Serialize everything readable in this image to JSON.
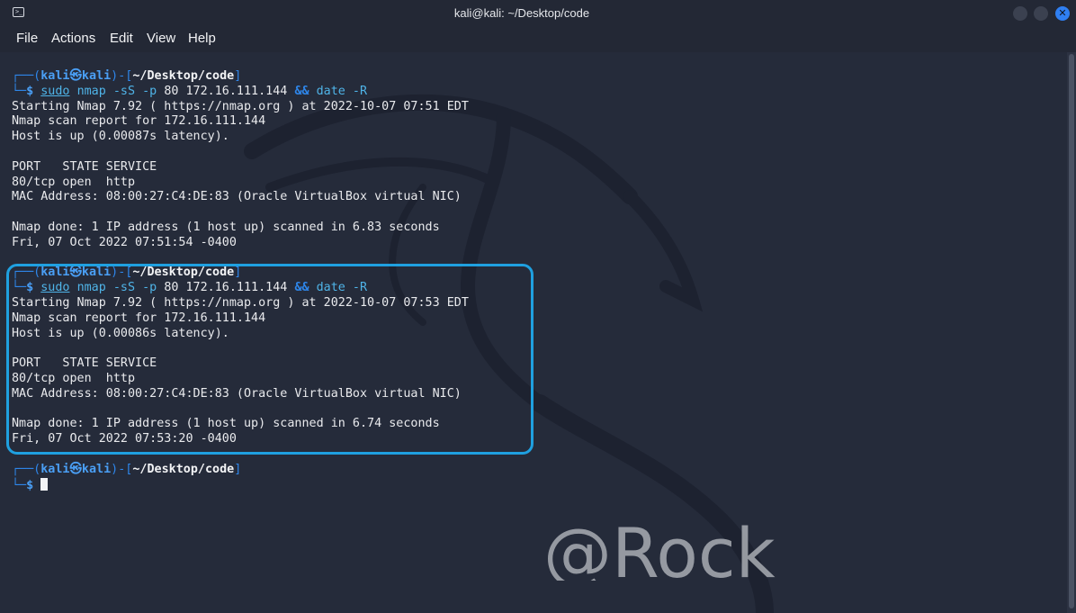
{
  "window": {
    "title": "kali@kali: ~/Desktop/code",
    "accent_color": "#2f7ff2",
    "icons": {
      "app": "terminal-icon",
      "close": "close-icon"
    }
  },
  "menu": [
    "File",
    "Actions",
    "Edit",
    "View",
    "Help"
  ],
  "terminal": {
    "prompt": {
      "user": "kali",
      "host": "kali",
      "at_symbol": "㉿",
      "path": "~/Desktop/code",
      "top_left": "┌──(",
      "bracket_mid": ")-[",
      "bracket_end": "]",
      "bottom_left": "└─",
      "dollar": "$"
    },
    "command": {
      "sudo": "sudo",
      "args": "nmap -sS -p",
      "target": "80 172.16.111.144",
      "amp": "&&",
      "date": "date -R"
    },
    "runs": [
      {
        "out": [
          "Starting Nmap 7.92 ( https://nmap.org ) at 2022-10-07 07:51 EDT",
          "Nmap scan report for 172.16.111.144",
          "Host is up (0.00087s latency).",
          "",
          "PORT   STATE SERVICE",
          "80/tcp open  http",
          "MAC Address: 08:00:27:C4:DE:83 (Oracle VirtualBox virtual NIC)",
          "",
          "Nmap done: 1 IP address (1 host up) scanned in 6.83 seconds",
          "Fri, 07 Oct 2022 07:51:54 -0400"
        ]
      },
      {
        "out": [
          "Starting Nmap 7.92 ( https://nmap.org ) at 2022-10-07 07:53 EDT",
          "Nmap scan report for 172.16.111.144",
          "Host is up (0.00086s latency).",
          "",
          "PORT   STATE SERVICE",
          "80/tcp open  http",
          "MAC Address: 08:00:27:C4:DE:83 (Oracle VirtualBox virtual NIC)",
          "",
          "Nmap done: 1 IP address (1 host up) scanned in 6.74 seconds",
          "Fri, 07 Oct 2022 07:53:20 -0400"
        ]
      }
    ],
    "highlight_color": "#1fa0e0"
  },
  "watermark": "@Rock"
}
